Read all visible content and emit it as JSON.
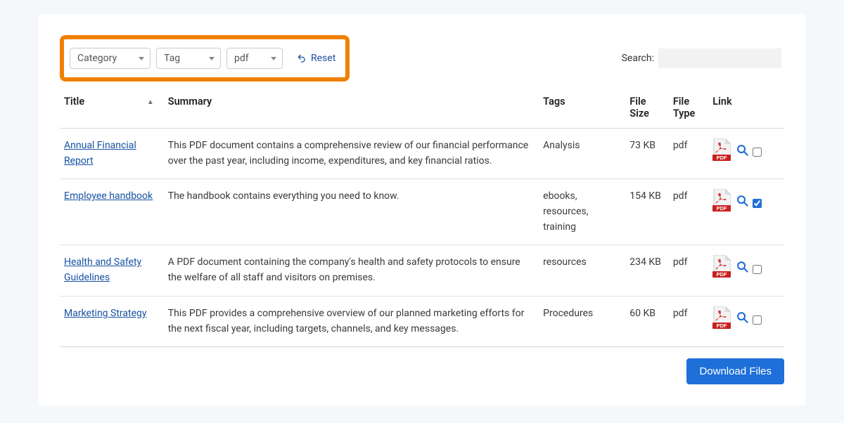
{
  "filters": {
    "category_label": "Category",
    "tag_label": "Tag",
    "filetype_value": "pdf",
    "reset_label": "Reset"
  },
  "search": {
    "label": "Search:",
    "value": ""
  },
  "columns": {
    "title": "Title",
    "summary": "Summary",
    "tags": "Tags",
    "file_size": "File Size",
    "file_type": "File Type",
    "link": "Link"
  },
  "sort": {
    "column": "title",
    "direction": "asc"
  },
  "rows": [
    {
      "title": "Annual Financial Report",
      "summary": "This PDF document contains a comprehensive review of our financial performance over the past year, including income, expenditures, and key financial ratios.",
      "tags": "Analysis",
      "size": "73 KB",
      "type": "pdf",
      "checked": false
    },
    {
      "title": "Employee handbook",
      "summary": "The handbook contains everything you need to know.",
      "tags": "ebooks, resources, training",
      "size": "154 KB",
      "type": "pdf",
      "checked": true
    },
    {
      "title": "Health and Safety Guidelines",
      "summary": "A PDF document containing the company's health and safety protocols to ensure the welfare of all staff and visitors on premises.",
      "tags": "resources",
      "size": "234 KB",
      "type": "pdf",
      "checked": false
    },
    {
      "title": "Marketing Strategy",
      "summary": "This PDF provides a comprehensive overview of our planned marketing efforts for the next fiscal year, including targets, channels, and key messages.",
      "tags": "Procedures",
      "size": "60 KB",
      "type": "pdf",
      "checked": false
    }
  ],
  "footer": {
    "download_label": "Download Files"
  },
  "icons": {
    "pdf_badge": "PDF"
  }
}
